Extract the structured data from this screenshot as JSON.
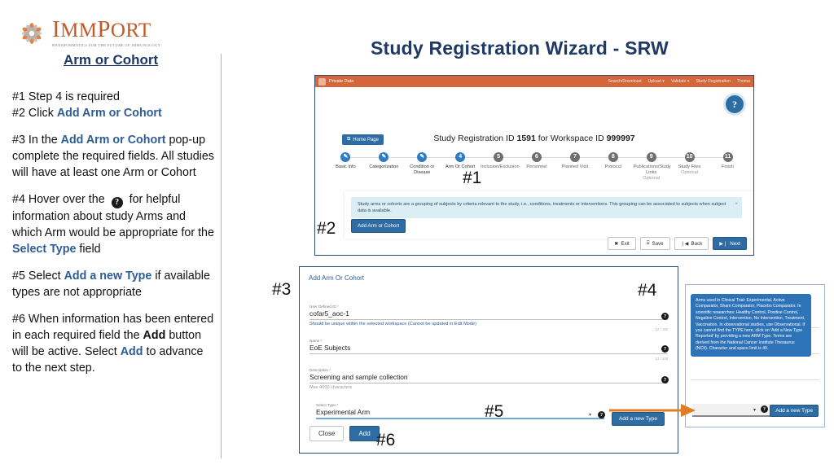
{
  "brand": {
    "name": "ImmPort",
    "name_caps": "I",
    "name_rest": "MM",
    "name_p": "P",
    "name_ort": "ORT",
    "tagline": "BIOINFORMATICS FOR THE FUTURE OF IMMUNOLOGY",
    "accent_color": "#C05A28"
  },
  "left_panel": {
    "title": "Arm or Cohort",
    "steps": [
      {
        "id": "#1",
        "prefix": "#1  Step 4 is required"
      },
      {
        "id": "#2",
        "prefix": "#2  Click ",
        "link": "Add Arm or Cohort"
      },
      {
        "id": "#3",
        "prefix": "#3  In the ",
        "link": "Add Arm or Cohort",
        "suffix": " pop-up complete the required fields.  All studies will have at least one Arm or Cohort"
      },
      {
        "id": "#4",
        "prefix": "#4 Hover over the ",
        "icon": "question-icon",
        "suffix_a": " for helpful information about study Arms and which Arm would be appropriate for the ",
        "link": "Select Type",
        "suffix_b": " field"
      },
      {
        "id": "#5",
        "prefix": "#5 Select ",
        "link": "Add a new Type",
        "suffix": " if available types are not appropriate"
      },
      {
        "id": "#6",
        "prefix": "#6 When information has been entered in each required field the ",
        "bold": "Add",
        "mid": " button will be active.  Select ",
        "link": "Add",
        "suffix": " to advance to the next step."
      }
    ]
  },
  "main_title": "Study Registration Wizard - SRW",
  "screenshot_top": {
    "topbar": {
      "brand": "Private Data",
      "menu": [
        "Search/Download",
        "Upload",
        "Validate",
        "Study Registration",
        "Thoma"
      ]
    },
    "help_fab": "?",
    "home_button": "Home Page",
    "heading_pre": "Study Registration ID ",
    "heading_id": "1591",
    "heading_mid": " for Workspace ID ",
    "heading_ws": "999997",
    "wizard_steps": [
      {
        "num": "1",
        "label": "Basic Info",
        "state": "done"
      },
      {
        "num": "2",
        "label": "Categorization",
        "state": "done"
      },
      {
        "num": "3",
        "label": "Condition or Disease",
        "state": "done"
      },
      {
        "num": "4",
        "label": "Arm Or Cohort",
        "state": "current"
      },
      {
        "num": "5",
        "label": "Inclusion/Exclusion",
        "state": "pending"
      },
      {
        "num": "6",
        "label": "Personnel",
        "state": "pending"
      },
      {
        "num": "7",
        "label": "Planned Visit",
        "state": "pending"
      },
      {
        "num": "8",
        "label": "Protocol",
        "state": "pending"
      },
      {
        "num": "9",
        "label": "Publications/Study Links",
        "label_opt": "Optional",
        "state": "pending"
      },
      {
        "num": "10",
        "label": "Study Files",
        "label_opt": "Optional",
        "state": "pending"
      },
      {
        "num": "11",
        "label": "Finish",
        "state": "pending"
      }
    ],
    "alert_text": "Study arms or cohorts are a grouping of subjects by criteria relevant to the study, i.e., conditions, treatments or interventions. This grouping can be associated to subjects when subject data is available.",
    "alert_close": "×",
    "add_arm_button": "Add Arm or Cohort",
    "footer_buttons": [
      {
        "label": "Exit",
        "icon": "✖",
        "primary": false
      },
      {
        "label": "Save",
        "icon": "⌸",
        "primary": false
      },
      {
        "label": "Back",
        "icon": "❘◀",
        "primary": false
      },
      {
        "label": "Next",
        "icon": "▶❘",
        "primary": true
      }
    ]
  },
  "dialog": {
    "title": "Add Arm Or Cohort",
    "fields": [
      {
        "label": "User Defined ID",
        "required": true,
        "value": "cofar5_aoc-1",
        "help": "Should be unique within the selected workspace  (Cannot be updated in Edit Mode)",
        "count": "12 / 100"
      },
      {
        "label": "Name",
        "required": true,
        "value": "EoE Subjects",
        "help": "",
        "count": "12 / 128"
      },
      {
        "label": "Description",
        "required": true,
        "value": "Screening and sample collection",
        "help": "Max 4000 characters",
        "count": ""
      }
    ],
    "select": {
      "label": "Select Type",
      "required": true,
      "value": "Experimental Arm"
    },
    "add_new_type_button": "Add a new Type",
    "close_button": "Close",
    "add_button": "Add"
  },
  "tooltip_panel": {
    "text": "Arms used in Clinical Trial: Experimental, Active Comparator, Sham Comparator, Placebo Comparator. In scientific researches: Healthy Control, Positive Control, Negative Control, Intervention, No Intervention, Treatment, Vaccination. In observational studies, use Observational. If you cannot find the TYPE here, click on 'Add a New Type Reported' by providing a new ARM Type. Terms are derived from the National Cancer Institute Thesaurus (NCIt). Character and space limit is 40.",
    "add_new_type_button": "Add a new Type",
    "background_color": "#2E72B8"
  },
  "callouts": [
    {
      "label": "#1"
    },
    {
      "label": "#2"
    },
    {
      "label": "#3"
    },
    {
      "label": "#4"
    },
    {
      "label": "#5"
    },
    {
      "label": "#6"
    }
  ],
  "colors": {
    "title_blue": "#1F3864",
    "link_blue": "#2E5C95",
    "orange_bar": "#D4663B",
    "button_blue": "#2E6DA4",
    "arrow_orange": "#E07B26"
  }
}
